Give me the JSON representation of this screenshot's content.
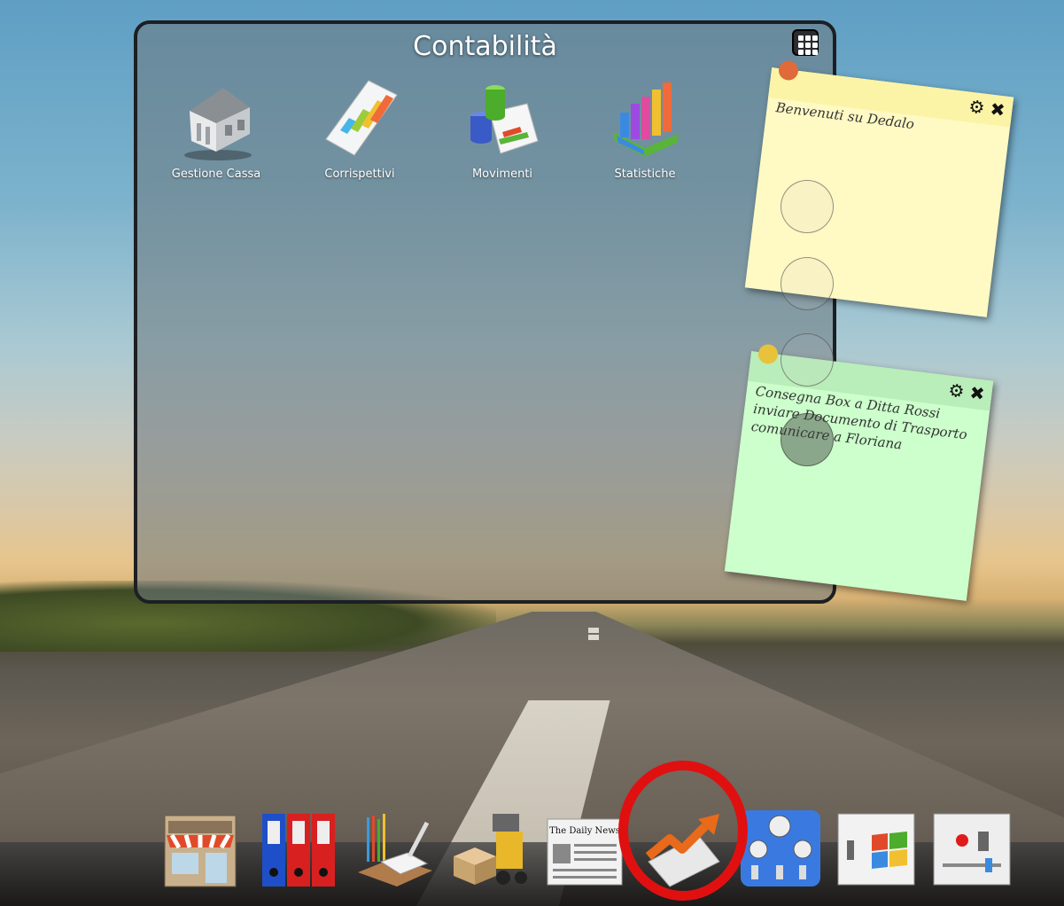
{
  "window": {
    "title": "Contabilità",
    "apps": [
      {
        "label": "Gestione Cassa",
        "icon": "bank-icon"
      },
      {
        "label": "Corrispettivi",
        "icon": "spreadsheet-icon"
      },
      {
        "label": "Movimenti",
        "icon": "database-chart-icon"
      },
      {
        "label": "Statistiche",
        "icon": "bar-chart-icon"
      }
    ]
  },
  "notes": [
    {
      "text": "Benvenuti su Dedalo",
      "color": "#fff9c4",
      "head_color": "#fbf3a6",
      "pin_color": "#e06a3a"
    },
    {
      "text": "Consegna Box a Ditta Rossi\ninviare Documento di Trasporto\ncomunicare a Floriana",
      "color": "#ccffcc",
      "head_color": "#b9edb9",
      "pin_color": "#e8c23a"
    }
  ],
  "dock": [
    {
      "icon": "store-icon"
    },
    {
      "icon": "binders-icon"
    },
    {
      "icon": "desk-tools-icon"
    },
    {
      "icon": "forklift-icon"
    },
    {
      "icon": "newspaper-icon"
    },
    {
      "icon": "trend-chart-icon"
    },
    {
      "icon": "control-panel-icon"
    },
    {
      "icon": "windows-switch-icon"
    },
    {
      "icon": "power-panel-icon"
    }
  ],
  "newspaper_title": "The Daily News",
  "accent_color": "#e01010"
}
